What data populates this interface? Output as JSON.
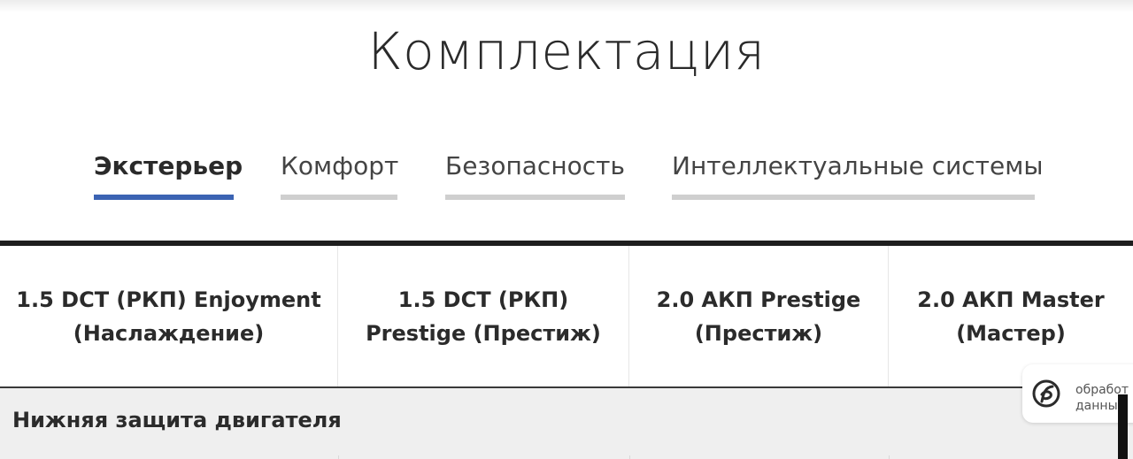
{
  "page": {
    "title": "Комплектация"
  },
  "tabs": [
    {
      "label": "Экстерьер",
      "active": true
    },
    {
      "label": "Комфорт",
      "active": false
    },
    {
      "label": "Безопасность",
      "active": false
    },
    {
      "label": "Интеллектуальные системы",
      "active": false
    }
  ],
  "trims": [
    {
      "line1": "1.5 DCT (РКП) Enjoyment",
      "line2": "(Наслаждение)"
    },
    {
      "line1": "1.5 DCT (РКП)",
      "line2": "Prestige (Престиж)"
    },
    {
      "line1": "2.0 АКП Prestige",
      "line2": "(Престиж)"
    },
    {
      "line1": "2.0 АКП Master",
      "line2": "(Мастер)"
    }
  ],
  "feature_rows": [
    {
      "label": "Нижняя защита двигателя"
    }
  ],
  "consent_widget": {
    "line1": "обработ",
    "line2": "данны"
  },
  "colors": {
    "accent": "#3b63b3",
    "tab_inactive": "#cfcfcf",
    "divider": "#1e1e1e",
    "row_bg": "#efefef"
  }
}
